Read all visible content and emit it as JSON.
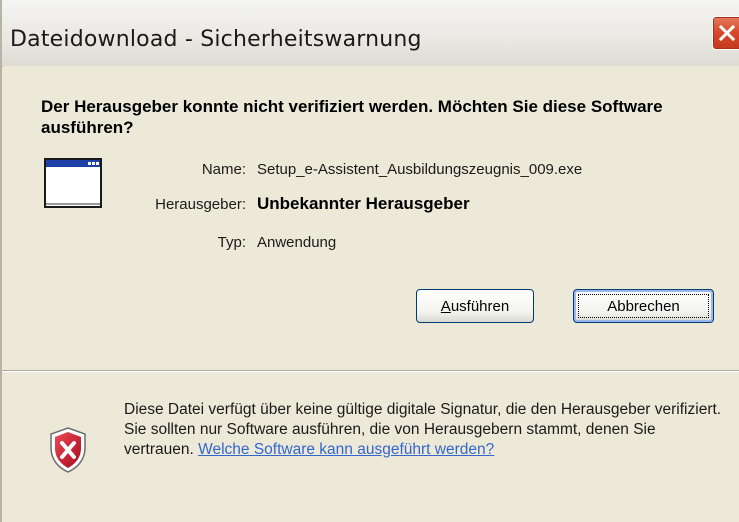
{
  "window": {
    "title": "Dateidownload - Sicherheitswarnung"
  },
  "main": {
    "question": "Der Herausgeber konnte nicht verifiziert werden. Möchten Sie diese Software ausführen?",
    "fields": {
      "name_label": "Name:",
      "name_value": "Setup_e-Assistent_Ausbildungszeugnis_009.exe",
      "publisher_label": "Herausgeber:",
      "publisher_value": "Unbekannter Herausgeber",
      "type_label": "Typ:",
      "type_value": "Anwendung"
    }
  },
  "buttons": {
    "run": "Ausführen",
    "cancel": "Abbrechen"
  },
  "footer": {
    "warning": "Diese Datei verfügt über keine gültige digitale Signatur, die den Herausgeber verifiziert. Sie sollten nur Software ausführen, die von Herausgebern stammt, denen Sie vertrauen.",
    "link": "Welche Software kann ausgeführt werden?"
  },
  "colors": {
    "dialog_background": "#ece9d8",
    "link": "#3366cc",
    "close_button": "#d6462a",
    "shield_red": "#c8102e"
  },
  "icons": {
    "close": "close-icon",
    "application": "application-window-icon",
    "warning": "security-shield-icon"
  }
}
